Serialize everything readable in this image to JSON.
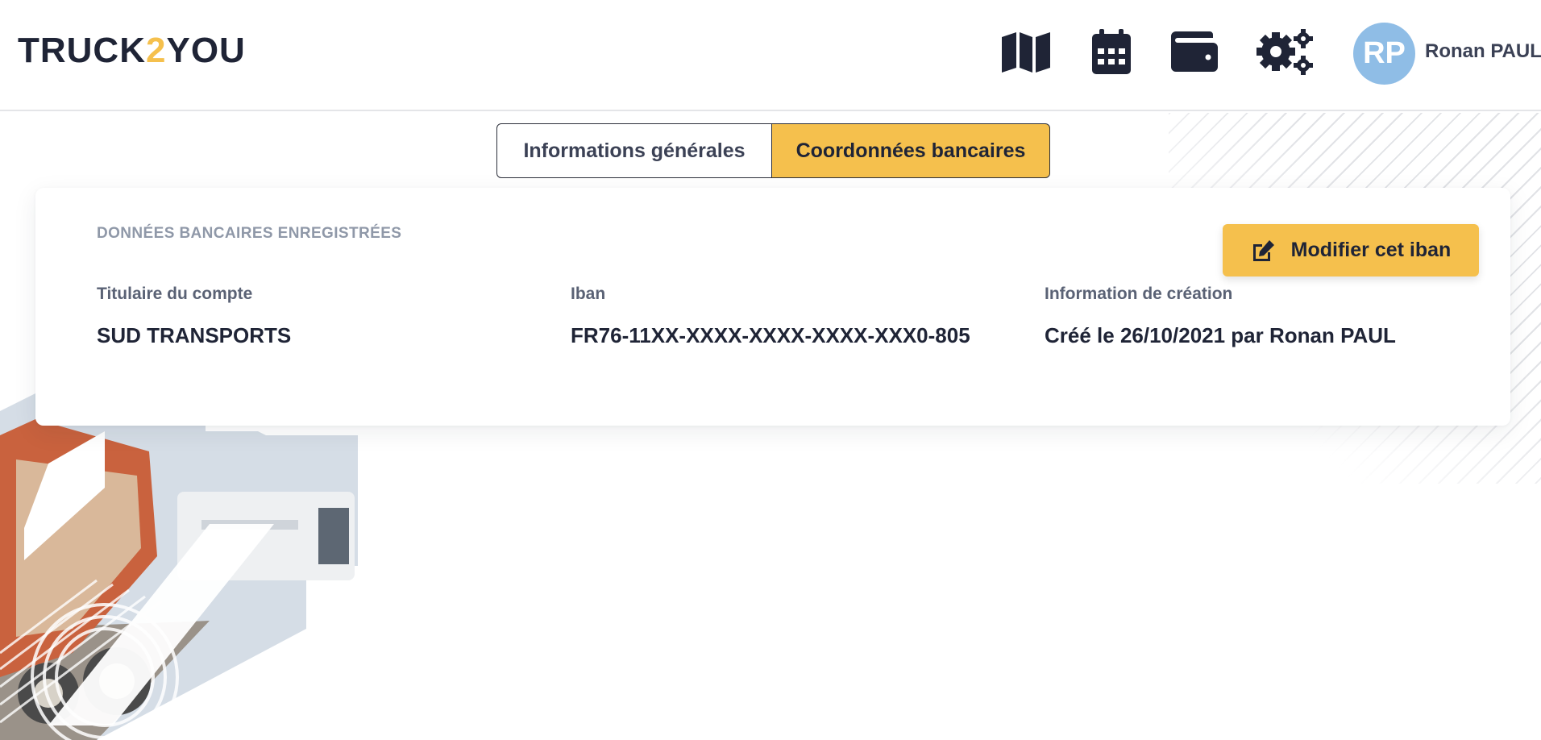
{
  "brand": {
    "logo_left": "TRUCK",
    "logo_mid": "2",
    "logo_right": "YOU",
    "accent": "#f5c04d"
  },
  "header": {
    "nav_icons": [
      "map-icon",
      "calendar-icon",
      "wallet-icon",
      "settings-icon"
    ],
    "user": {
      "initials": "RP",
      "name": "Ronan PAUL",
      "avatar_color": "#8fbde6"
    }
  },
  "tabs": [
    {
      "label": "Informations générales",
      "active": false
    },
    {
      "label": "Coordonnées bancaires",
      "active": true
    }
  ],
  "bank": {
    "section_title": "DONNÉES BANCAIRES ENREGISTRÉES",
    "edit_button_label": "Modifier cet iban",
    "fields": [
      {
        "label": "Titulaire du compte",
        "value": "SUD TRANSPORTS"
      },
      {
        "label": "Iban",
        "value": "FR76-11XX-XXXX-XXXX-XXXX-XXX0-805"
      },
      {
        "label": "Information de création",
        "value": "Créé le 26/10/2021 par Ronan PAUL"
      }
    ]
  }
}
